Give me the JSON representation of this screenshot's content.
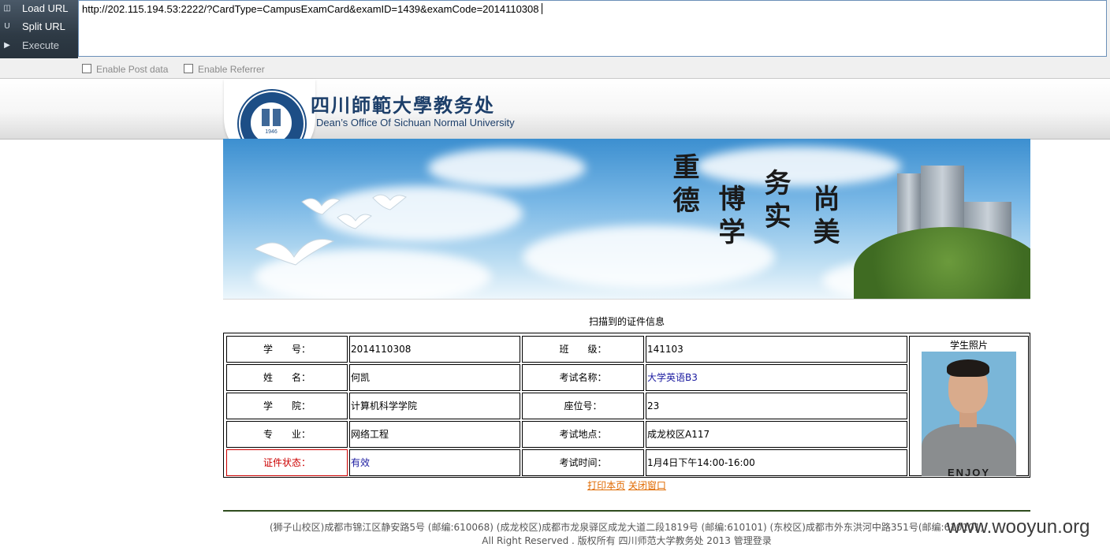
{
  "hackbar": {
    "menu": {
      "load_url": "Load URL",
      "split_url": "Split URL",
      "execute": "Execute"
    },
    "url_value": "http://202.115.194.53:2222/?CardType=CampusExamCard&examID=1439&examCode=2014110308",
    "options": {
      "post_data": "Enable Post data",
      "referrer": "Enable Referrer"
    }
  },
  "header": {
    "title_cn": "四川師範大學教务处",
    "title_en": "Dean’s Office Of Sichuan Normal University",
    "seal_year": "1946"
  },
  "banner": {
    "calligraphy": [
      "重德",
      "博学",
      "务实",
      "尚美"
    ]
  },
  "card": {
    "caption": "扫描到的证件信息",
    "photo_label": "学生照片",
    "photo_shirt_text": "ENJOY",
    "rows": [
      {
        "label_left": "学　　号：",
        "value_left": "2014110308",
        "label_right": "班　　级：",
        "value_right": "141103"
      },
      {
        "label_left": "姓　　名：",
        "value_left": "何凯",
        "label_right": "考试名称：",
        "value_right": "大学英语B3"
      },
      {
        "label_left": "学　　院：",
        "value_left": "计算机科学学院",
        "label_right": "座位号：",
        "value_right": "23"
      },
      {
        "label_left": "专　　业：",
        "value_left": "网络工程",
        "label_right": "考试地点：",
        "value_right": "成龙校区A117"
      },
      {
        "label_left": "证件状态：",
        "value_left": "有效",
        "label_right": "考试时间：",
        "value_right": "1月4日下午14:00-16:00"
      }
    ]
  },
  "actions": {
    "print": "打印本页",
    "close": "关闭窗口"
  },
  "footer": {
    "address": "(狮子山校区)成都市锦江区静安路5号 (邮编:610068) (成龙校区)成都市龙泉驿区成龙大道二段1819号 (邮编:610101) (东校区)成都市外东洪河中路351号(邮编:610101)",
    "copyright": "All Right Reserved . 版权所有 四川师范大学教务处 2013",
    "admin_login": "管理登录"
  },
  "watermark": "www.wooyun.org",
  "colors": {
    "hackbar_menu": "#2e3a45",
    "brand_blue": "#1d3f6a",
    "status_red": "#cc0000",
    "link_orange": "#e06a00",
    "value_blue": "#1a1aa0",
    "footer_green": "#2f4d1e"
  }
}
